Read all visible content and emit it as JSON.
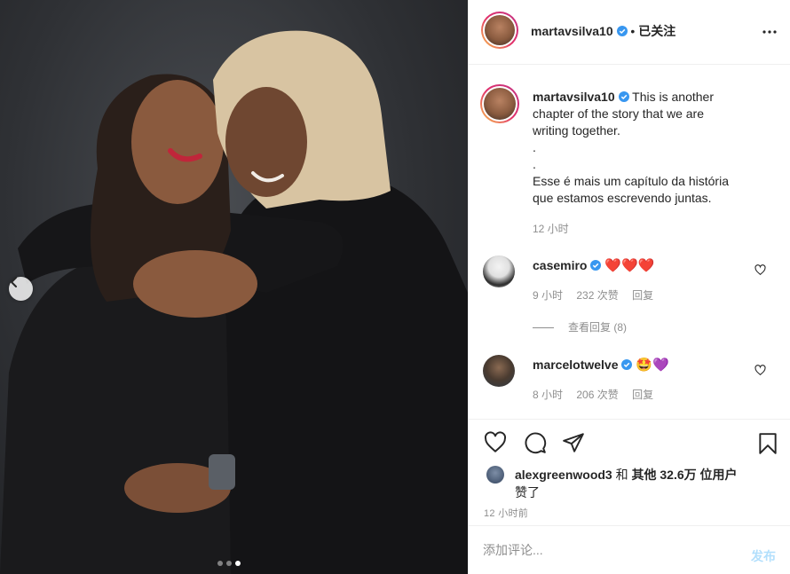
{
  "post": {
    "author": "martavsilva10",
    "follow_state": "已关注",
    "separator": "•",
    "caption_lines": [
      "This is another",
      "chapter of the story that we are",
      "writing together.",
      ".",
      ".",
      "Esse é mais um capítulo da história",
      "que estamos escrevendo juntas."
    ],
    "caption_time": "12 小时",
    "carousel": {
      "slides": 3,
      "active_index": 2
    }
  },
  "comments": [
    {
      "user": "casemiro",
      "text": "❤️❤️❤️",
      "time": "9 小时",
      "likes": "232 次赞",
      "reply": "回复",
      "view_replies": "查看回复 (8)"
    },
    {
      "user": "marcelotwelve",
      "text": "🤩💜",
      "time": "8 小时",
      "likes": "206 次赞",
      "reply": "回复"
    }
  ],
  "engagement": {
    "liker": "alexgreenwood3",
    "and": "和",
    "others": "其他 32.6万 位用户",
    "liked_suffix": "赞了",
    "post_time": "12 小时前"
  },
  "comment_box": {
    "placeholder": "添加评论...",
    "post_label": "发布"
  },
  "colors": {
    "verified": "#3897f0",
    "link_disabled": "#b2dffc",
    "muted": "#8e8e8e",
    "text": "#262626"
  },
  "icons": [
    "chevron-left-icon",
    "more-icon",
    "heart-icon",
    "comment-icon",
    "share-icon",
    "bookmark-icon",
    "verified-icon"
  ]
}
